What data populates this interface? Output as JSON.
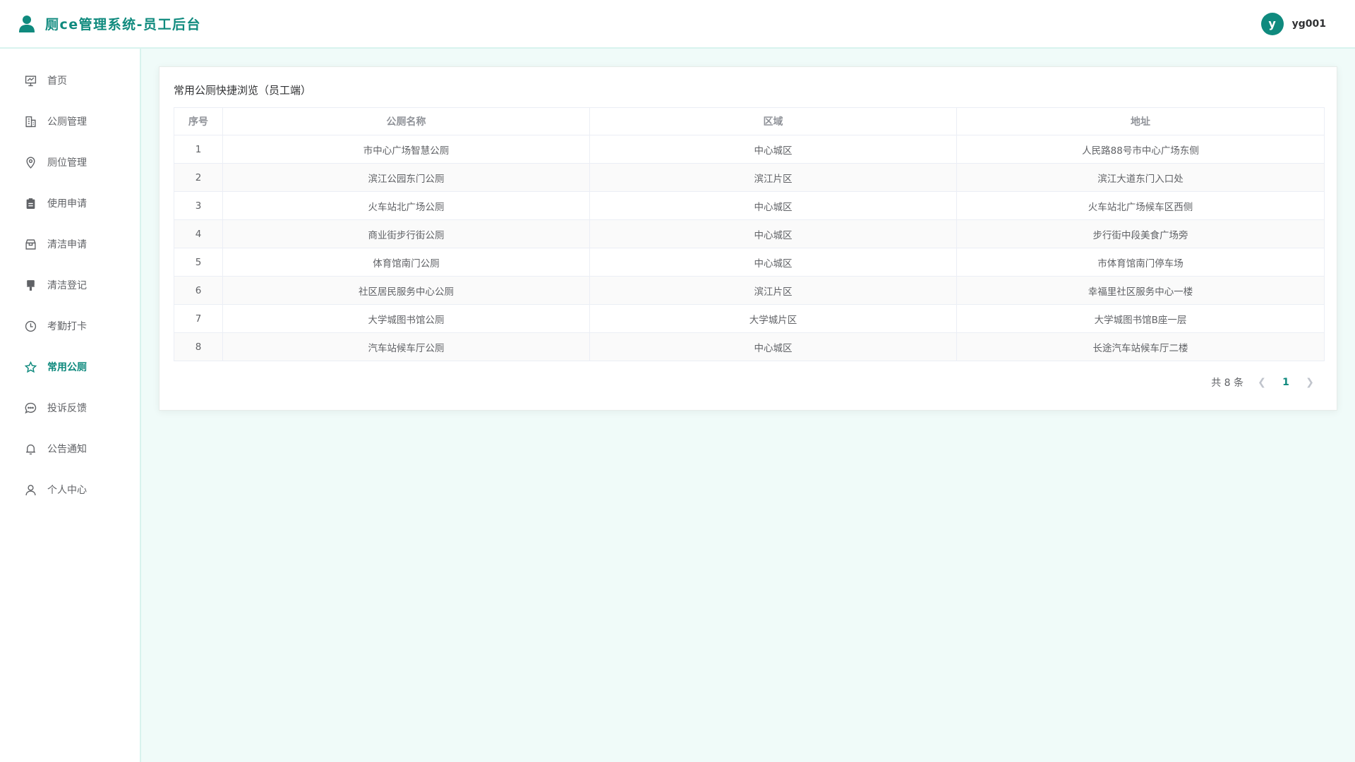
{
  "header": {
    "title": "厕ce管理系统-员工后台",
    "avatar_letter": "y",
    "username": "yg001"
  },
  "colors": {
    "accent": "#0f8a7e",
    "background": "#f0fbf9"
  },
  "sidebar": {
    "items": [
      {
        "label": "首页",
        "icon": "presentation-icon",
        "active": false
      },
      {
        "label": "公厕管理",
        "icon": "building-icon",
        "active": false
      },
      {
        "label": "厕位管理",
        "icon": "location-pin-icon",
        "active": false
      },
      {
        "label": "使用申请",
        "icon": "clipboard-icon",
        "active": false
      },
      {
        "label": "清洁申请",
        "icon": "box-icon",
        "active": false
      },
      {
        "label": "清洁登记",
        "icon": "brush-icon",
        "active": false
      },
      {
        "label": "考勤打卡",
        "icon": "clock-icon",
        "active": false
      },
      {
        "label": "常用公厕",
        "icon": "star-icon",
        "active": true
      },
      {
        "label": "投诉反馈",
        "icon": "chat-bubble-icon",
        "active": false
      },
      {
        "label": "公告通知",
        "icon": "bell-icon",
        "active": false
      },
      {
        "label": "个人中心",
        "icon": "user-icon",
        "active": false
      }
    ]
  },
  "main": {
    "card_title": "常用公厕快捷浏览（员工端）",
    "table": {
      "headers": [
        "序号",
        "公厕名称",
        "区域",
        "地址"
      ],
      "rows": [
        [
          "1",
          "市中心广场智慧公厕",
          "中心城区",
          "人民路88号市中心广场东侧"
        ],
        [
          "2",
          "滨江公园东门公厕",
          "滨江片区",
          "滨江大道东门入口处"
        ],
        [
          "3",
          "火车站北广场公厕",
          "中心城区",
          "火车站北广场候车区西侧"
        ],
        [
          "4",
          "商业街步行街公厕",
          "中心城区",
          "步行街中段美食广场旁"
        ],
        [
          "5",
          "体育馆南门公厕",
          "中心城区",
          "市体育馆南门停车场"
        ],
        [
          "6",
          "社区居民服务中心公厕",
          "滨江片区",
          "幸福里社区服务中心一楼"
        ],
        [
          "7",
          "大学城图书馆公厕",
          "大学城片区",
          "大学城图书馆B座一层"
        ],
        [
          "8",
          "汽车站候车厅公厕",
          "中心城区",
          "长途汽车站候车厅二楼"
        ]
      ]
    },
    "pagination": {
      "total_text": "共 8 条",
      "current_page": "1",
      "prev_icon": "chevron-left-icon",
      "next_icon": "chevron-right-icon"
    }
  }
}
